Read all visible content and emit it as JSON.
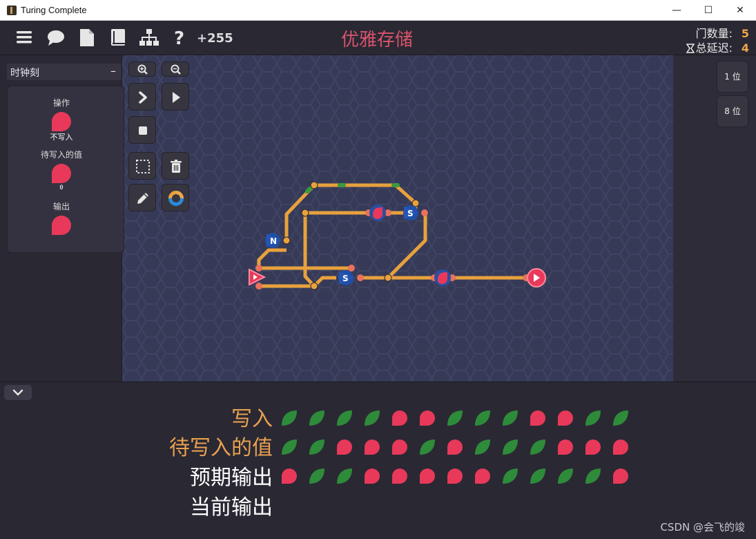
{
  "window": {
    "title": "Turing Complete",
    "minimize_glyph": "—",
    "maximize_glyph": "☐",
    "close_glyph": "✕"
  },
  "toolbar": {
    "icons": [
      "menu-icon",
      "chat-icon",
      "document-icon",
      "book-icon",
      "hierarchy-icon",
      "help-icon"
    ],
    "score": "+255",
    "level_title": "优雅存储",
    "gate_count_label": "门数量:",
    "gate_count_value": "5",
    "delay_label": "总延迟:",
    "delay_value": "4"
  },
  "left_panel": {
    "section_title": "时钟刻",
    "collapse_glyph": "–",
    "io": [
      {
        "label": "操作",
        "value": "不写入"
      },
      {
        "label": "待写入的值",
        "value": "0"
      },
      {
        "label": "输出",
        "value": ""
      }
    ]
  },
  "tools": [
    "zoom-in-icon",
    "zoom-out-icon",
    "step-icon",
    "play-icon",
    "stop-icon",
    "select-icon",
    "delete-icon",
    "pencil-icon",
    "color-wheel-icon"
  ],
  "right_panel": {
    "bit_buttons": [
      "1 位",
      "8 位"
    ]
  },
  "board": {
    "gate_labels": [
      "N",
      "S",
      "S"
    ]
  },
  "bottom": {
    "rows": [
      {
        "label": "写入",
        "color": "orange",
        "pattern": [
          "g",
          "g",
          "g",
          "g",
          "r",
          "r",
          "g",
          "g",
          "g",
          "r",
          "r",
          "g",
          "g"
        ]
      },
      {
        "label": "待写入的值",
        "color": "orange",
        "pattern": [
          "g",
          "g",
          "r",
          "r",
          "r",
          "g",
          "r",
          "g",
          "g",
          "g",
          "r",
          "r",
          "r"
        ]
      },
      {
        "label": "预期输出",
        "color": "white",
        "pattern": [
          "r",
          "g",
          "g",
          "r",
          "r",
          "r",
          "r",
          "r",
          "g",
          "g",
          "g",
          "g",
          "r"
        ]
      },
      {
        "label": "当前输出",
        "color": "white",
        "pattern": []
      }
    ],
    "watermark": "CSDN @会飞的竣"
  },
  "colors": {
    "wire": "#e8a13d",
    "red": "#e8395a",
    "green": "#2e8b3a",
    "title_red": "#d8546b",
    "orange": "#e8a14f"
  }
}
